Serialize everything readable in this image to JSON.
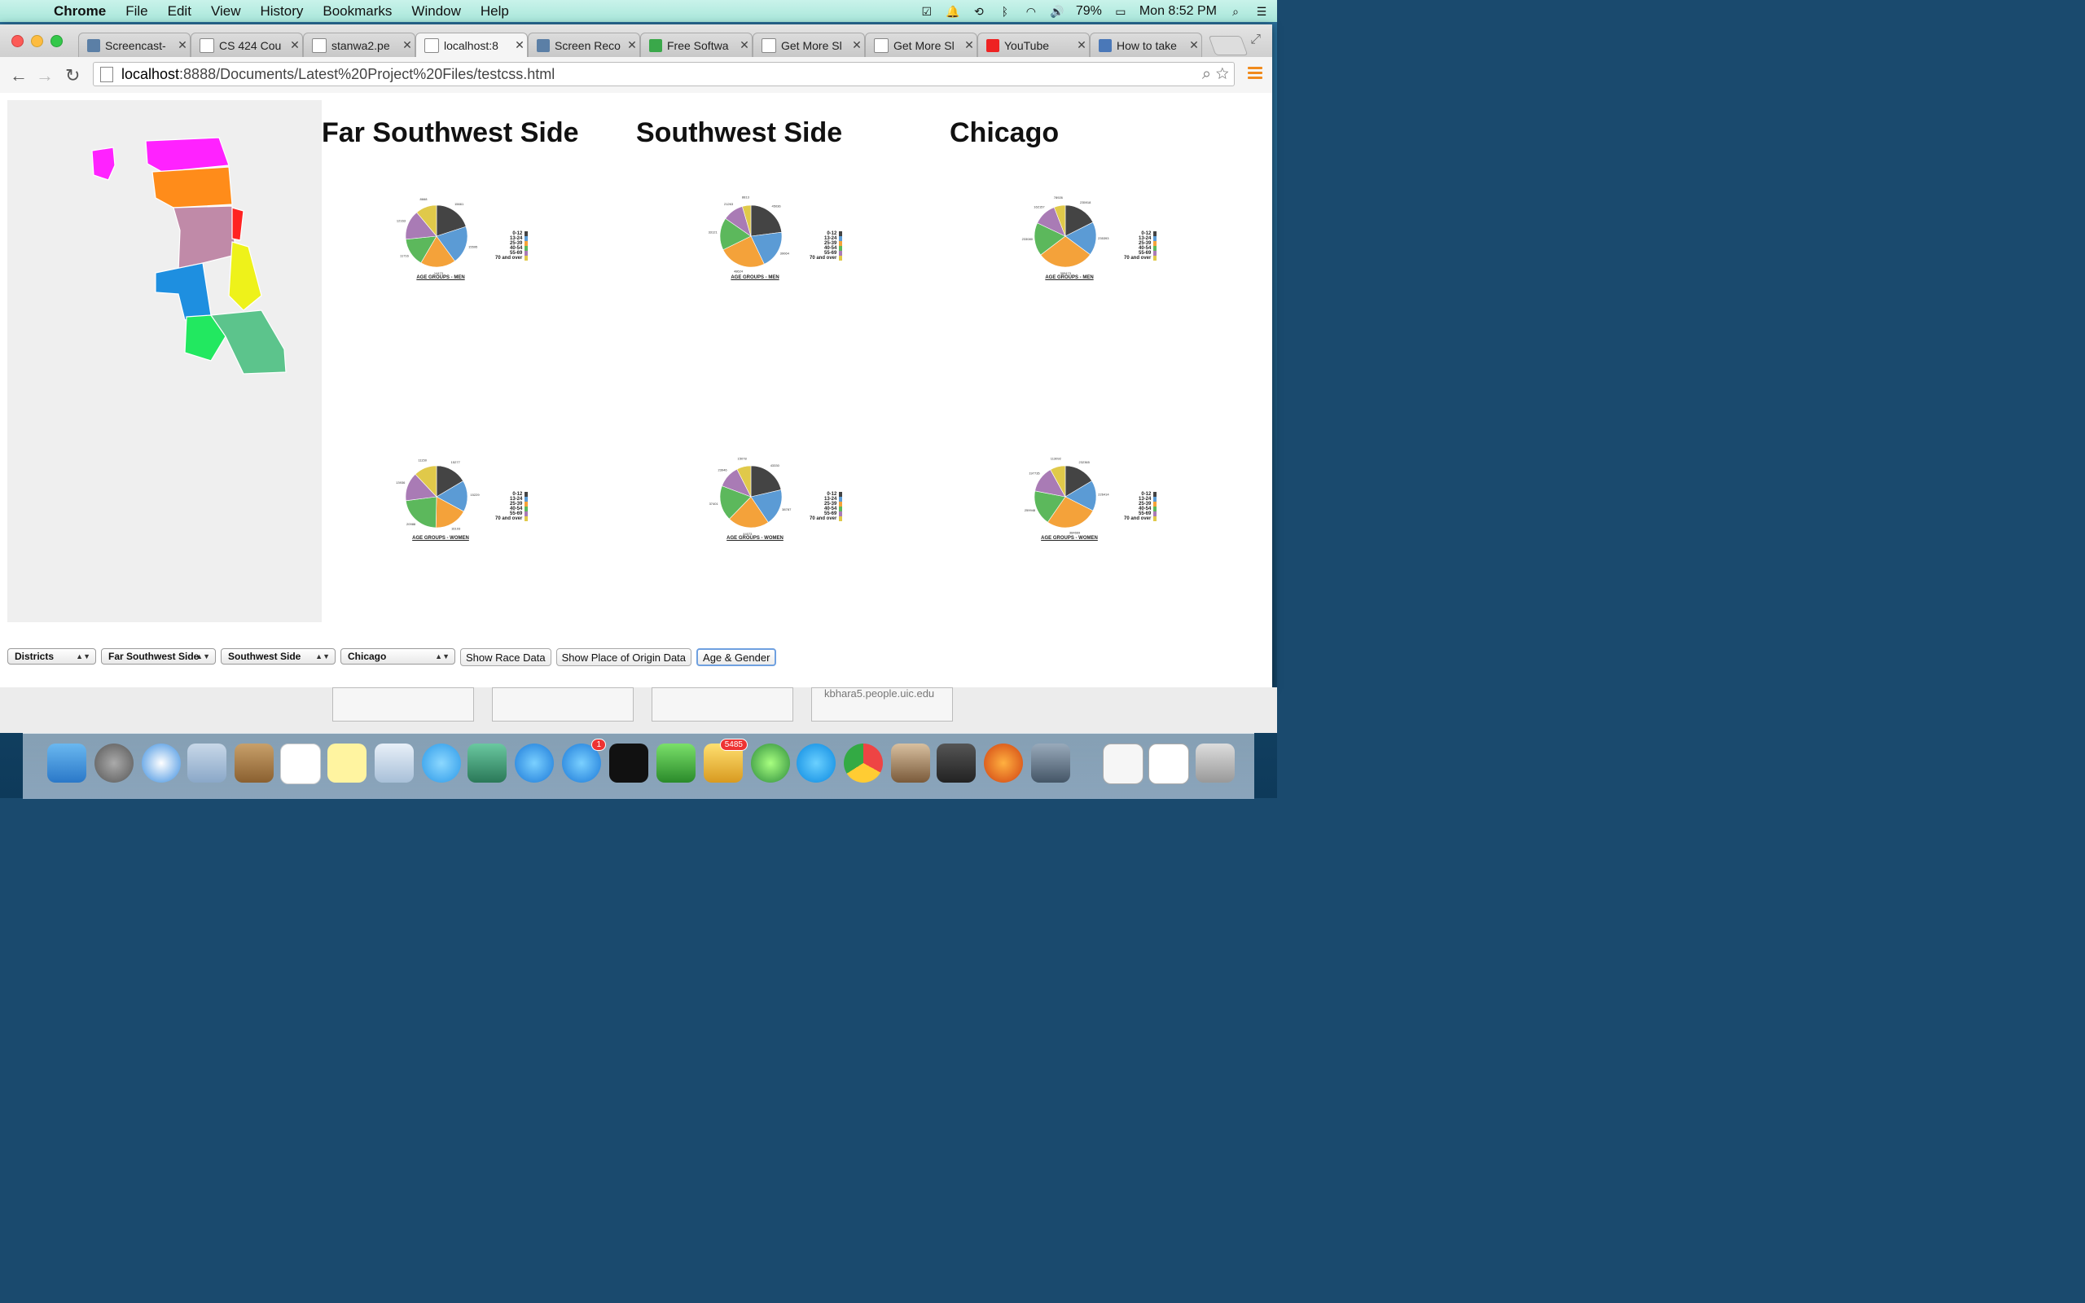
{
  "menubar": {
    "app_name": "Chrome",
    "menus": [
      "File",
      "Edit",
      "View",
      "History",
      "Bookmarks",
      "Window",
      "Help"
    ],
    "battery": "79%",
    "clock": "Mon 8:52 PM"
  },
  "tabs": [
    {
      "title": "Screencast-",
      "favicon": "som-icon",
      "active": false
    },
    {
      "title": "CS 424 Cou",
      "favicon": "page-icon",
      "active": false
    },
    {
      "title": "stanwa2.pe",
      "favicon": "page-icon",
      "active": false
    },
    {
      "title": "localhost:8",
      "favicon": "page-icon",
      "active": true
    },
    {
      "title": "Screen Reco",
      "favicon": "som-icon",
      "active": false
    },
    {
      "title": "Free Softwa",
      "favicon": "check-icon",
      "active": false
    },
    {
      "title": "Get More Sl",
      "favicon": "page-icon",
      "active": false
    },
    {
      "title": "Get More Sl",
      "favicon": "page-icon",
      "active": false
    },
    {
      "title": "YouTube",
      "favicon": "youtube-icon",
      "active": false
    },
    {
      "title": "How to take",
      "favicon": "screen-icon",
      "active": false
    }
  ],
  "address": {
    "host": "localhost",
    "rest": ":8888/Documents/Latest%20Project%20Files/testcss.html"
  },
  "regions": [
    "Far Southwest Side",
    "Southwest Side",
    "Chicago"
  ],
  "captions": {
    "men": "AGE GROUPS - MEN",
    "women": "AGE GROUPS - WOMEN"
  },
  "legend": [
    {
      "label": "0-12",
      "color": "#444444"
    },
    {
      "label": "13-24",
      "color": "#5b9bd5"
    },
    {
      "label": "25-39",
      "color": "#f4a23a"
    },
    {
      "label": "40-54",
      "color": "#5cb85c"
    },
    {
      "label": "55-69",
      "color": "#a97bb5"
    },
    {
      "label": "70 and over",
      "color": "#e0c94a"
    }
  ],
  "chart_data": [
    {
      "type": "pie",
      "region": "Far Southwest Side",
      "title": "AGE GROUPS - MEN",
      "categories": [
        "0-12",
        "13-24",
        "25-39",
        "40-54",
        "55-69",
        "70 and over"
      ],
      "values": [
        15661,
        15595,
        14473,
        11716,
        12163,
        8668
      ]
    },
    {
      "type": "pie",
      "region": "Southwest Side",
      "title": "AGE GROUPS - MEN",
      "categories": [
        "0-12",
        "13-24",
        "25-39",
        "40-54",
        "55-69",
        "70 and over"
      ],
      "values": [
        45036,
        39064,
        48624,
        33121,
        21263,
        8813
      ]
    },
    {
      "type": "pie",
      "region": "Chicago",
      "title": "AGE GROUPS - MEN",
      "categories": [
        "0-12",
        "13-24",
        "25-39",
        "40-54",
        "55-69",
        "70 and over"
      ],
      "values": [
        235918,
        235393,
        395473,
        233080,
        162157,
        78926
      ]
    },
    {
      "type": "pie",
      "region": "Far Southwest Side",
      "title": "AGE GROUPS - WOMEN",
      "categories": [
        "0-12",
        "13-24",
        "25-39",
        "40-54",
        "55-69",
        "70 and over"
      ],
      "values": [
        15277,
        15229,
        16193,
        20988,
        13936,
        11150
      ]
    },
    {
      "type": "pie",
      "region": "Southwest Side",
      "title": "AGE GROUPS - WOMEN",
      "categories": [
        "0-12",
        "13-24",
        "25-39",
        "40-54",
        "55-69",
        "70 and over"
      ],
      "values": [
        43330,
        38787,
        44073,
        37401,
        23946,
        15078
      ]
    },
    {
      "type": "pie",
      "region": "Chicago",
      "title": "AGE GROUPS - WOMEN",
      "categories": [
        "0-12",
        "13-24",
        "25-39",
        "40-54",
        "55-69",
        "70 and over"
      ],
      "values": [
        232365,
        226414,
        384669,
        259948,
        197735,
        113092
      ]
    }
  ],
  "controls": {
    "select1": "Districts",
    "select2": "Far Southwest Side",
    "select3": "Southwest Side",
    "select4": "Chicago",
    "race_btn": "Show Race Data",
    "origin_btn": "Show Place of Origin Data",
    "age_btn": "Age & Gender"
  },
  "behind_text": "kbhara5.people.uic.edu",
  "dock_badges": {
    "appstore": "1",
    "mail": "5485"
  },
  "map_colors": [
    "#ff22ff",
    "#ff8c1a",
    "#c08aa8",
    "#ff2222",
    "#1e8fe0",
    "#eef21a",
    "#22e860",
    "#5cc48c"
  ]
}
